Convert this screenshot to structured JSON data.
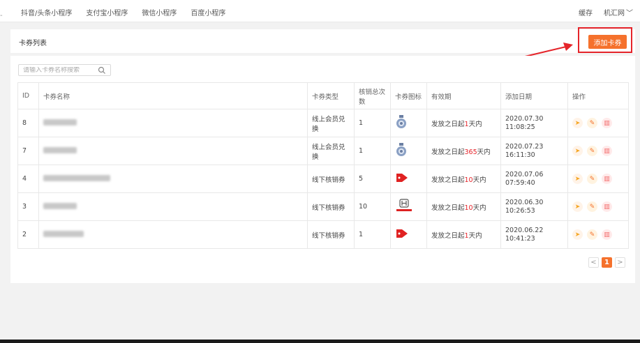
{
  "top_nav": {
    "tabs": [
      "抖音/头条小程序",
      "支付宝小程序",
      "微信小程序",
      "百度小程序"
    ],
    "cache_label": "缓存",
    "user_label": "机汇网"
  },
  "header": {
    "title": "卡券列表",
    "add_button": "添加卡券"
  },
  "search": {
    "placeholder": "请输入卡券名称搜索"
  },
  "table": {
    "headers": [
      "ID",
      "卡券名称",
      "卡券类型",
      "核销总次数",
      "卡券图标",
      "有效期",
      "添加日期",
      "操作"
    ],
    "rows": [
      {
        "id": "8",
        "type": "线上会员兑换",
        "count": "1",
        "icon": "medal-icon",
        "validity_prefix": "发放之日起",
        "validity_num": "1",
        "validity_suffix": "天内",
        "date": "2020.07.30 11:08:25"
      },
      {
        "id": "7",
        "type": "线上会员兑换",
        "count": "1",
        "icon": "medal-icon",
        "validity_prefix": "发放之日起",
        "validity_num": "365",
        "validity_suffix": "天内",
        "date": "2020.07.23 16:11:30"
      },
      {
        "id": "4",
        "type": "线下核销券",
        "count": "5",
        "icon": "tag-icon",
        "validity_prefix": "发放之日起",
        "validity_num": "10",
        "validity_suffix": "天内",
        "date": "2020.07.06 07:59:40"
      },
      {
        "id": "3",
        "type": "线下核销券",
        "count": "10",
        "icon": "honda-logo-icon",
        "validity_prefix": "发放之日起",
        "validity_num": "10",
        "validity_suffix": "天内",
        "date": "2020.06.30 10:26:53"
      },
      {
        "id": "2",
        "type": "线下核销券",
        "count": "1",
        "icon": "tag-icon",
        "validity_prefix": "发放之日起",
        "validity_num": "1",
        "validity_suffix": "天内",
        "date": "2020.06.22 10:41:23"
      }
    ]
  },
  "pagination": {
    "current": "1",
    "prev": "<",
    "next": ">"
  },
  "colors": {
    "accent": "#f5712c",
    "annotation": "#e5242a"
  }
}
